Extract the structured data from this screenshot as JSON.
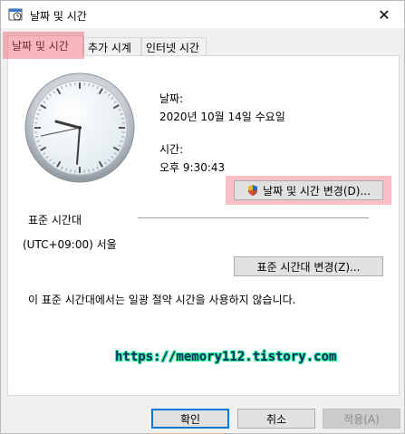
{
  "window": {
    "title": "날짜 및 시간",
    "close_glyph": "✕"
  },
  "tabs": [
    {
      "label": "날짜 및 시간",
      "active": true
    },
    {
      "label": "추가 시계",
      "active": false
    },
    {
      "label": "인터넷 시간",
      "active": false
    }
  ],
  "datetime": {
    "date_label": "날짜:",
    "date_value": "2020년 10월 14일 수요일",
    "time_label": "시간:",
    "time_value": "오후 9:30:43",
    "change_button": "날짜 및 시간 변경(D)..."
  },
  "clock": {
    "hour": 9,
    "minute": 30,
    "second": 43
  },
  "timezone": {
    "heading": "표준 시간대",
    "value": "(UTC+09:00) 서울",
    "change_button": "표준 시간대 변경(Z)...",
    "dst_note": "이 표준 시간대에서는 일광 절약 시간을 사용하지 않습니다."
  },
  "watermark": "https://memory112.tistory.com",
  "footer": {
    "ok": "확인",
    "cancel": "취소",
    "apply": "적용(A)"
  },
  "colors": {
    "highlight": "#f05a6e",
    "accent": "#0078d7"
  }
}
